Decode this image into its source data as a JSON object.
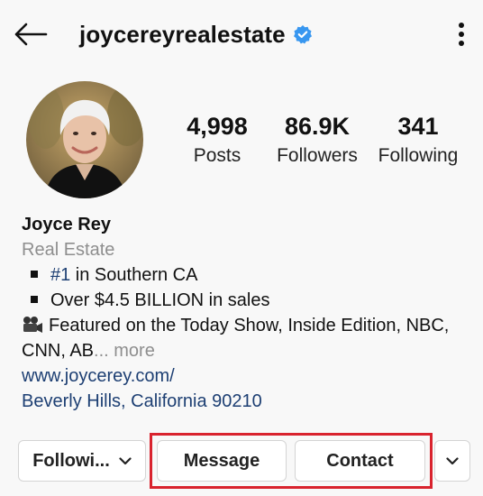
{
  "header": {
    "username": "joycereyrealestate",
    "back_icon": "arrow-left-icon",
    "verified_icon": "verified-badge-icon",
    "more_icon": "vertical-ellipsis-icon"
  },
  "stats": {
    "posts": {
      "value": "4,998",
      "label": "Posts"
    },
    "followers": {
      "value": "86.9K",
      "label": "Followers"
    },
    "following": {
      "value": "341",
      "label": "Following"
    }
  },
  "bio": {
    "name": "Joyce Rey",
    "category": "Real Estate",
    "line1_hashtag": "#1",
    "line1_rest": " in Southern CA",
    "line2": "Over $4.5 BILLION in sales",
    "line3": "Featured on the Today Show, Inside Edition, NBC,",
    "line4_text": "CNN, AB",
    "line4_more": "... more",
    "website": "www.joycerey.com/",
    "location": "Beverly Hills, California 90210"
  },
  "actions": {
    "following_label": "Followi...",
    "message_label": "Message",
    "contact_label": "Contact"
  },
  "colors": {
    "link": "#1d3f73",
    "verified": "#3897f0",
    "highlight": "#d9232e",
    "muted": "#8e8e8e"
  }
}
